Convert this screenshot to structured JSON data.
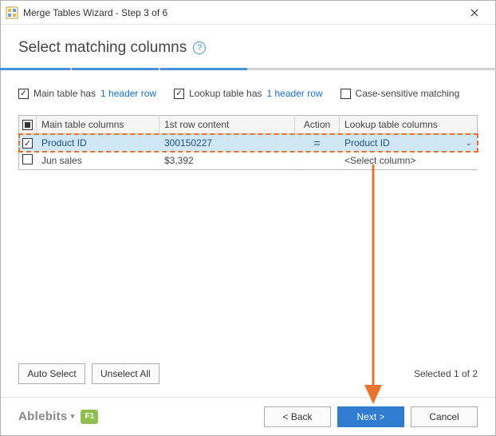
{
  "window": {
    "title": "Merge Tables Wizard - Step 3 of 6"
  },
  "heading": "Select matching columns",
  "progress": {
    "total": 6,
    "current": 3
  },
  "options": {
    "main_has_label_pre": "Main table has",
    "main_has_link": "1 header row",
    "lookup_has_label_pre": "Lookup table has",
    "lookup_has_link": "1 header row",
    "case_sensitive_label": "Case-sensitive matching"
  },
  "table": {
    "headers": {
      "main": "Main table columns",
      "content": "1st row content",
      "action": "Action",
      "lookup": "Lookup table columns"
    },
    "rows": [
      {
        "checked": true,
        "selected": true,
        "main": "Product ID",
        "content": "300150227",
        "action": "=",
        "lookup": "Product ID",
        "dropdown": true
      },
      {
        "checked": false,
        "selected": false,
        "main": "Jun sales",
        "content": "$3,392",
        "action": "",
        "lookup": "<Select column>",
        "dropdown": false
      }
    ]
  },
  "buttons": {
    "auto_select": "Auto Select",
    "unselect_all": "Unselect All",
    "back": "< Back",
    "next": "Next >",
    "cancel": "Cancel"
  },
  "selection_status": "Selected 1 of 2",
  "footer": {
    "brand": "Ablebits",
    "help_key": "F1"
  }
}
